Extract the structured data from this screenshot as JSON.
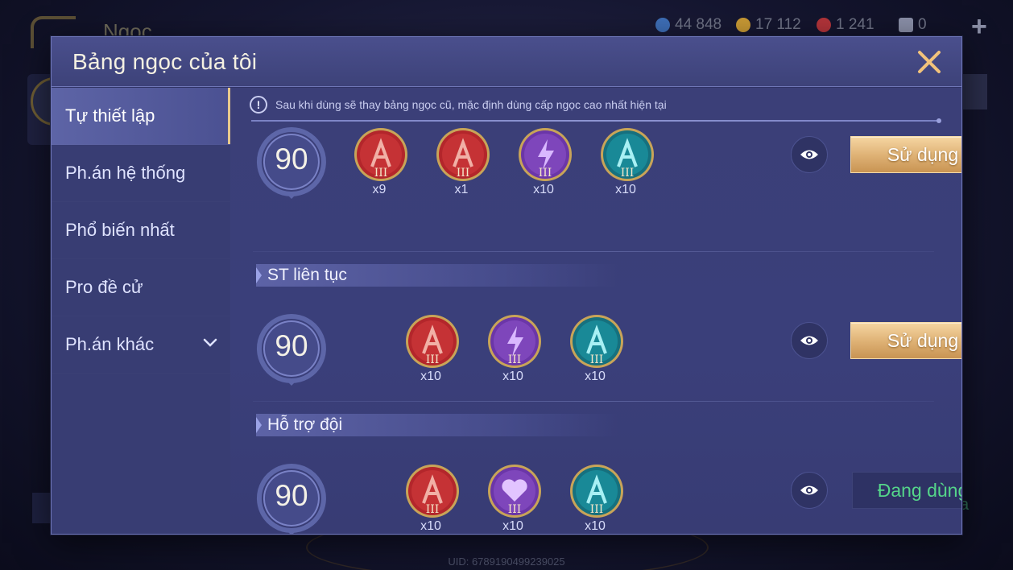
{
  "background": {
    "title": "Ngọc",
    "currencies": [
      {
        "icon": "diamond-icon",
        "value": "44 848",
        "color": "#3e6fb8"
      },
      {
        "icon": "gold-coin-icon",
        "value": "17 112",
        "color": "#c99a35"
      },
      {
        "icon": "ruby-icon",
        "value": "1 241",
        "color": "#b3343a"
      },
      {
        "icon": "ticket-icon",
        "value": "0",
        "color": "#8a8fa8"
      }
    ],
    "uid": "UID: 6789190499239025",
    "right_text": "a"
  },
  "modal": {
    "title": "Bảng ngọc của tôi",
    "close_icon": "close-icon"
  },
  "sidebar": {
    "items": [
      {
        "label": "Tự thiết lập",
        "active": true
      },
      {
        "label": "Ph.án hệ thống",
        "active": false
      },
      {
        "label": "Phổ biến nhất",
        "active": false
      },
      {
        "label": "Pro đề cử",
        "active": false
      },
      {
        "label": "Ph.án khác",
        "active": false,
        "expandable": true
      }
    ]
  },
  "content": {
    "notice": "Sau khi dùng sẽ thay bảng ngọc cũ, mặc định dùng cấp ngọc cao nhất hiện tại",
    "rows": [
      {
        "title": "",
        "level": "90",
        "gems": [
          {
            "type": "red",
            "tier": "III",
            "count": "x9"
          },
          {
            "type": "red",
            "tier": "III",
            "count": "x1"
          },
          {
            "type": "purple-lightning",
            "tier": "III",
            "count": "x10"
          },
          {
            "type": "teal",
            "tier": "III",
            "count": "x10"
          }
        ],
        "action": "Sử dụng",
        "in_use": false
      },
      {
        "title": "ST liên tục",
        "level": "90",
        "gems": [
          {
            "type": "red",
            "tier": "III",
            "count": "x10"
          },
          {
            "type": "purple-lightning",
            "tier": "III",
            "count": "x10"
          },
          {
            "type": "teal",
            "tier": "III",
            "count": "x10"
          }
        ],
        "action": "Sử dụng",
        "in_use": false
      },
      {
        "title": "Hỗ trợ đội",
        "level": "90",
        "gems": [
          {
            "type": "red",
            "tier": "III",
            "count": "x10"
          },
          {
            "type": "purple-heart",
            "tier": "III",
            "count": "x10"
          },
          {
            "type": "teal",
            "tier": "III",
            "count": "x10"
          }
        ],
        "action": "Đang dùng",
        "in_use": true
      }
    ]
  },
  "colors": {
    "accent_gold": "#ddb073",
    "in_use_green": "#55d68a",
    "modal_bg": "#303466"
  }
}
